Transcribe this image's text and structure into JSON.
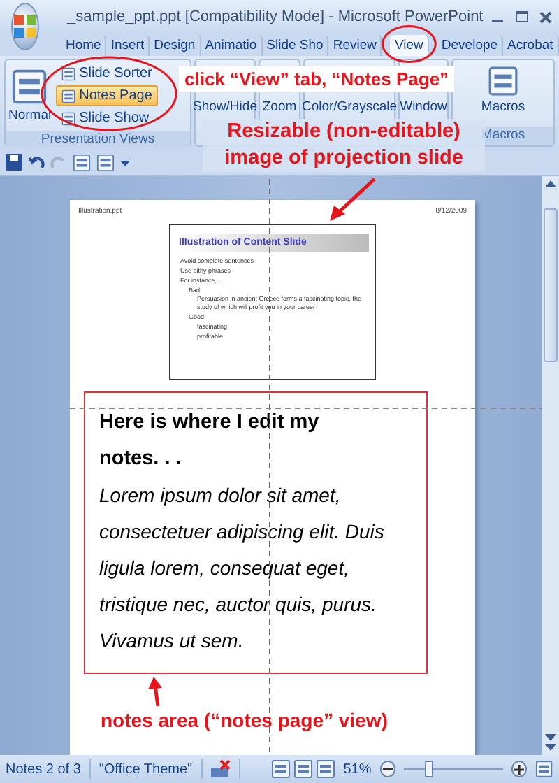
{
  "window": {
    "title": "_sample_ppt.ppt [Compatibility Mode] - Microsoft PowerPoint"
  },
  "tabs": [
    {
      "label": "Home",
      "selected": false
    },
    {
      "label": "Insert",
      "selected": false
    },
    {
      "label": "Design",
      "selected": false
    },
    {
      "label": "Animatio",
      "selected": false
    },
    {
      "label": "Slide Sho",
      "selected": false
    },
    {
      "label": "Review",
      "selected": false
    },
    {
      "label": "View",
      "selected": true
    },
    {
      "label": "Develope",
      "selected": false
    },
    {
      "label": "Acrobat",
      "selected": false
    }
  ],
  "ribbon": {
    "normal": "Normal",
    "views": [
      {
        "label": "Slide Sorter",
        "selected": false
      },
      {
        "label": "Notes Page",
        "selected": true
      },
      {
        "label": "Slide Show",
        "selected": false
      }
    ],
    "group_label": "Presentation Views",
    "groups": [
      {
        "label": "Show/Hide"
      },
      {
        "label": "Zoom"
      },
      {
        "label": "Color/Grayscale"
      },
      {
        "label": "Window"
      },
      {
        "label": "Macros",
        "group_label": "Macros"
      }
    ]
  },
  "annotations": {
    "tab_hint": "click “View” tab, “Notes Page”",
    "slide_hint": "Resizable (non-editable) image of projection slide",
    "notes_hint": "notes area (“notes page” view)"
  },
  "page": {
    "header_left": "Illustration.ppt",
    "header_right": "8/12/2009",
    "slide": {
      "title": "Illustration of Content Slide",
      "bullets": [
        {
          "text": "Avoid complete sentences"
        },
        {
          "text": "Use pithy phrases"
        },
        {
          "text": "For instance, …",
          "children": [
            {
              "text": "Bad:",
              "children": [
                {
                  "text": "Persuasion in ancient Greece forms a fascinating topic, the study of which will profit you in your career"
                }
              ]
            },
            {
              "text": "Good:",
              "children": [
                {
                  "text": "fascinating"
                },
                {
                  "text": "profitable"
                }
              ]
            }
          ]
        }
      ]
    },
    "notes": {
      "heading": "Here is where I edit my notes. . .",
      "body": "Lorem ipsum dolor sit amet, consectetuer adipiscing elit. Duis ligula lorem, consequat eget, tristique nec, auctor quis, purus. Vivamus ut sem."
    }
  },
  "status_bar": {
    "slide": "Notes 2 of 3",
    "theme": "\"Office Theme\"",
    "zoom": "51%",
    "zoom_slider": {
      "level": 0.25
    }
  }
}
